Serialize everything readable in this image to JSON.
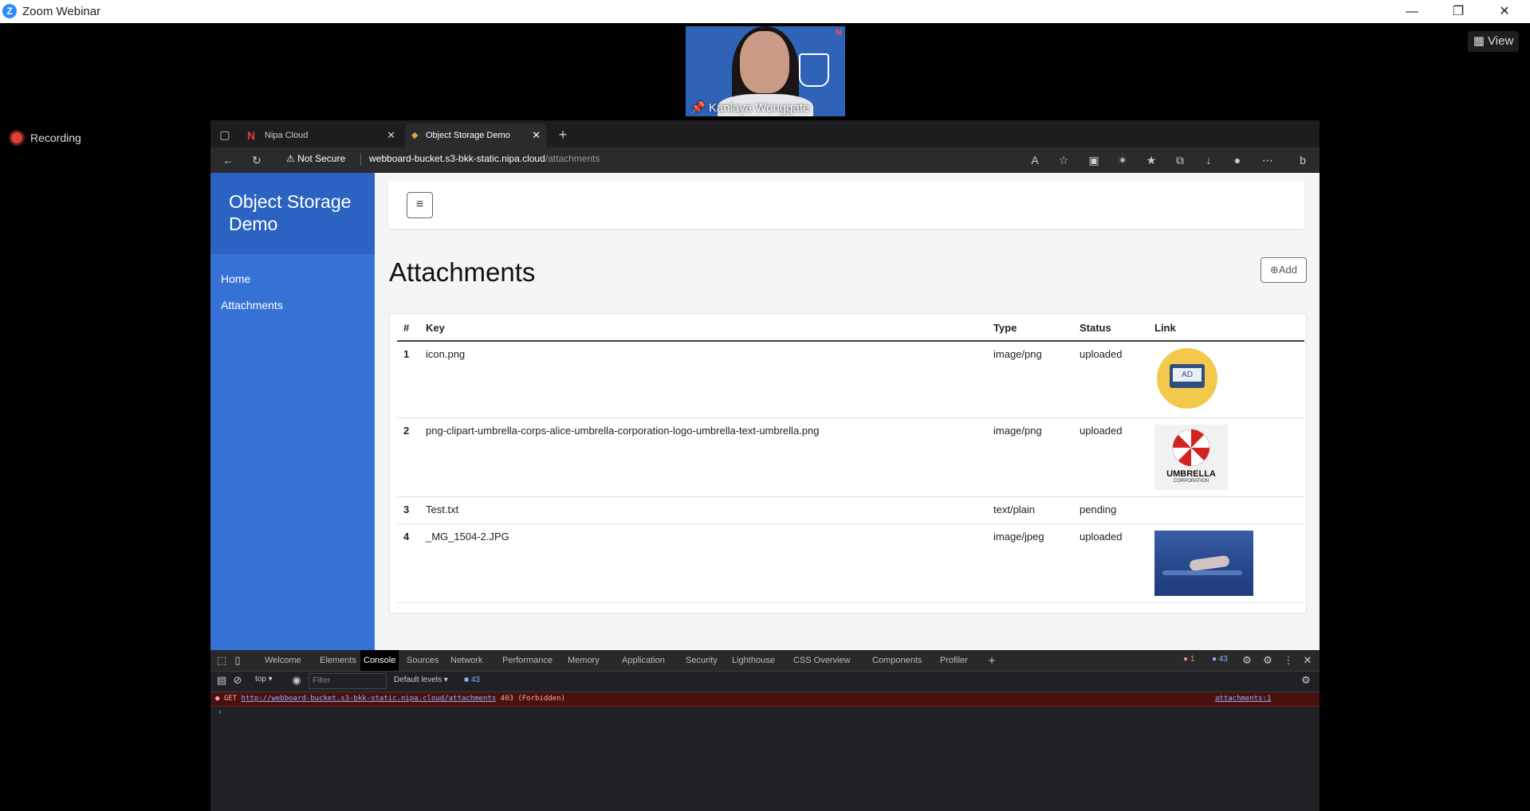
{
  "zoom": {
    "title": "Zoom Webinar",
    "logo": "Z",
    "view_label": "View",
    "participant_name": "Kanlaya Wonggate",
    "recording_label": "Recording",
    "window_controls": [
      "minimize-icon",
      "restore-icon",
      "close-icon"
    ]
  },
  "browser": {
    "tabs": [
      {
        "label": "Nipa Cloud",
        "icon": "nipa-n-icon"
      },
      {
        "label": "Object Storage Demo",
        "icon": "shield-favicon",
        "active": true
      }
    ],
    "security_label": "Not Secure",
    "url_host": "webboard-bucket.s3-bkk-static.nipa.cloud",
    "url_path": "/attachments"
  },
  "app": {
    "brand": "Object Storage Demo",
    "nav": [
      {
        "label": "Home"
      },
      {
        "label": "Attachments"
      }
    ],
    "page_title": "Attachments",
    "add_button_label": "Add",
    "table": {
      "headers": [
        "#",
        "Key",
        "Type",
        "Status",
        "Link"
      ],
      "rows": [
        {
          "num": "1",
          "key": "icon.png",
          "type": "image/png",
          "status": "uploaded",
          "thumb": "ad-monitor-image",
          "thumb_text": "AD"
        },
        {
          "num": "2",
          "key": "png-clipart-umbrella-corps-alice-umbrella-corporation-logo-umbrella-text-umbrella.png",
          "type": "image/png",
          "status": "uploaded",
          "thumb": "umbrella-logo-image",
          "thumb_text": "UMBRELLA",
          "thumb_subtext": "CORPORATION"
        },
        {
          "num": "3",
          "key": "Test.txt",
          "type": "text/plain",
          "status": "pending",
          "thumb": ""
        },
        {
          "num": "4",
          "key": "_MG_1504-2.JPG",
          "type": "image/jpeg",
          "status": "uploaded",
          "thumb": "swimmer-photo-image"
        }
      ]
    }
  },
  "devtools": {
    "tabs": [
      "Welcome",
      "Elements",
      "Console",
      "Sources",
      "Network",
      "Performance",
      "Memory",
      "Application",
      "Security",
      "Lighthouse",
      "CSS Overview",
      "Components",
      "Profiler"
    ],
    "active_tab": "Console",
    "error_count": "1",
    "info_count": "43",
    "context": "top",
    "filter_placeholder": "Filter",
    "levels": "Default levels",
    "issues_count": "43",
    "error": {
      "method": "GET",
      "url": "http://webboard-bucket.s3-bkk-static.nipa.cloud/attachments",
      "status": "403 (Forbidden)",
      "source": "attachments:1"
    },
    "prompt": "›"
  }
}
